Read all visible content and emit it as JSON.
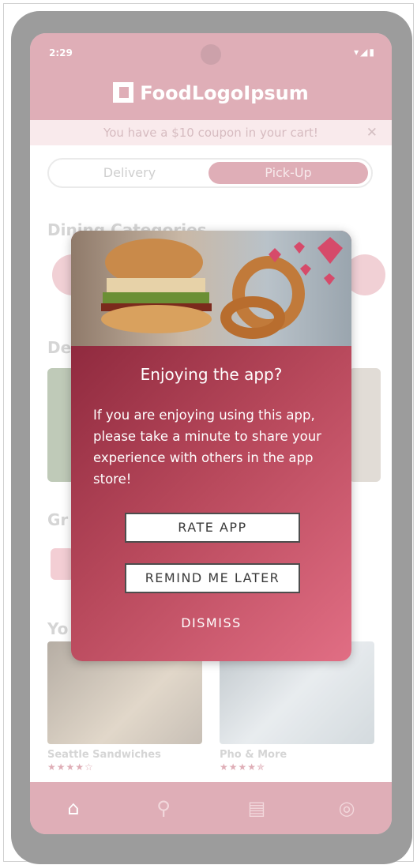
{
  "status_bar": {
    "time": "2:29",
    "icons": "▾◢▮"
  },
  "header": {
    "brand": "FoodLogoIpsum"
  },
  "coupon": {
    "text": "You have a $10 coupon in your cart!",
    "close": "✕"
  },
  "order_toggle": {
    "left": "Delivery",
    "right": "Pick-Up"
  },
  "sections": {
    "dining": "Dining Categories",
    "deals": "De",
    "groceries": "Gr",
    "yours": "Yo"
  },
  "restaurants": [
    {
      "name": "Seattle Sandwiches",
      "stars": "★★★★☆"
    },
    {
      "name": "Pho & More",
      "stars": "★★★★✯"
    }
  ],
  "modal": {
    "title": "Enjoying the app?",
    "body": "If you are enjoying using this app, please take a minute to share your experience with others in the app store!",
    "rate_label": "RATE APP",
    "remind_label": "REMIND ME LATER",
    "dismiss_label": "DISMISS"
  },
  "nav": {
    "home": "⌂",
    "search": "⚲",
    "orders": "▤",
    "profile": "◎"
  }
}
